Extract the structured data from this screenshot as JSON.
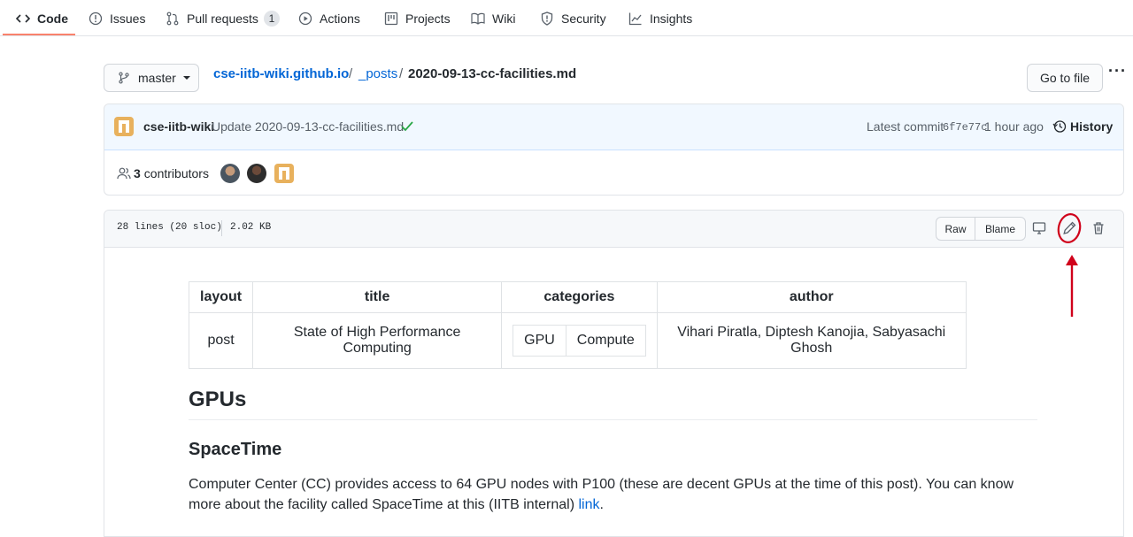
{
  "tabs": [
    {
      "label": "Code",
      "icon": "code-icon",
      "active": true
    },
    {
      "label": "Issues",
      "icon": "issue-icon"
    },
    {
      "label": "Pull requests",
      "icon": "pull-request-icon",
      "count": "1"
    },
    {
      "label": "Actions",
      "icon": "play-icon"
    },
    {
      "label": "Projects",
      "icon": "project-icon"
    },
    {
      "label": "Wiki",
      "icon": "book-icon"
    },
    {
      "label": "Security",
      "icon": "shield-icon"
    },
    {
      "label": "Insights",
      "icon": "graph-icon"
    }
  ],
  "branch": {
    "label": "master"
  },
  "breadcrumb": {
    "repo": "cse-iitb-wiki.github.io",
    "sep1": "/",
    "folder": "_posts",
    "sep2": "/",
    "file": "2020-09-13-cc-facilities.md"
  },
  "go_to_file": "Go to file",
  "more": "···",
  "commit": {
    "author": "cse-iitb-wiki",
    "message": "Update 2020-09-13-cc-facilities.md",
    "latest_label": "Latest commit",
    "sha": "6f7e77c",
    "time": "1 hour ago",
    "history": "History"
  },
  "contributors": {
    "count": "3",
    "label": "contributors"
  },
  "file_info": {
    "lines": "28 lines (20 sloc)",
    "size": "2.02 KB",
    "raw": "Raw",
    "blame": "Blame"
  },
  "front_matter": {
    "headers": [
      "layout",
      "title",
      "categories",
      "author"
    ],
    "layout": "post",
    "title": "State of High Performance Computing",
    "categories": [
      "GPU",
      "Compute"
    ],
    "author": "Vihari Piratla, Diptesh Kanojia, Sabyasachi Ghosh"
  },
  "content": {
    "h1": "GPUs",
    "h2": "SpaceTime",
    "paragraph": "Computer Center (CC) provides access to 64 GPU nodes with P100 (these are decent GPUs at the time of this post). You can know more about the facility called SpaceTime at this (IITB internal) ",
    "link": "link",
    "period": "."
  },
  "colors": {
    "accent_underline": "#f9826c",
    "link": "#0366d6",
    "annotation": "#d0021b",
    "check": "#28a745"
  }
}
